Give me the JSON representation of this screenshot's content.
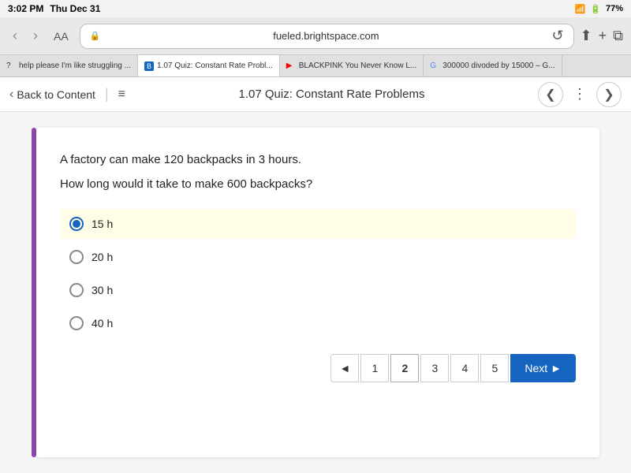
{
  "statusBar": {
    "time": "3:02 PM",
    "day": "Thu Dec 31",
    "wifi": "wifi",
    "battery": "77%"
  },
  "browser": {
    "backBtn": "‹",
    "forwardBtn": "›",
    "readerBtn": "AA",
    "url": "fueled.brightspace.com",
    "refreshBtn": "↺",
    "shareBtn": "⬆",
    "newTabBtn": "+",
    "tabsBtn": "⧉"
  },
  "tabs": [
    {
      "label": "help please I'm like struggling ...",
      "active": false,
      "favicon": "?"
    },
    {
      "label": "1.07 Quiz: Constant Rate Probl...",
      "active": true,
      "favicon": "B"
    },
    {
      "label": "BLACKPINK You Never Know L...",
      "active": false,
      "favicon": "▶"
    },
    {
      "label": "300000 divoded by 15000 – G...",
      "active": false,
      "favicon": "G"
    }
  ],
  "pageHeader": {
    "backLabel": "Back to Content",
    "menuIcon": "≡",
    "title": "1.07 Quiz: Constant Rate Problems",
    "prevIcon": "❮",
    "moreIcon": "⋮",
    "nextIcon": "❯"
  },
  "quiz": {
    "questionLine1": "A factory can make 120 backpacks in 3 hours.",
    "questionLine2": "How long would it take to make 600 backpacks?",
    "options": [
      {
        "id": "opt1",
        "label": "15 h",
        "selected": true
      },
      {
        "id": "opt2",
        "label": "20 h",
        "selected": false
      },
      {
        "id": "opt3",
        "label": "30 h",
        "selected": false
      },
      {
        "id": "opt4",
        "label": "40 h",
        "selected": false
      }
    ]
  },
  "pagination": {
    "prevIcon": "◄",
    "pages": [
      "1",
      "2",
      "3",
      "4",
      "5"
    ],
    "activePage": "2",
    "nextLabel": "Next",
    "nextIcon": "►"
  }
}
